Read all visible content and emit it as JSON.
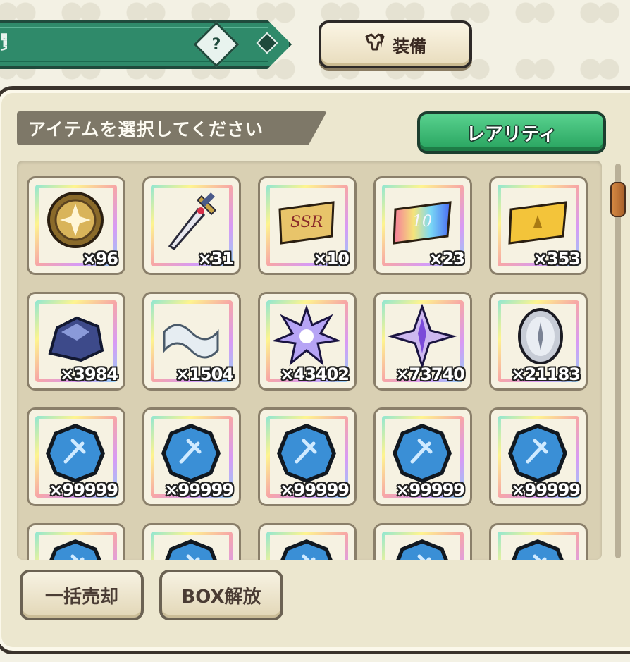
{
  "header": {
    "title_fragment": "覧",
    "help_label": "?",
    "equip_label": "装備",
    "equip_icon": "armor-icon"
  },
  "panel": {
    "instruction": "アイテムを選択してください",
    "rarity_label": "レアリティ"
  },
  "items": [
    {
      "icon": "gold-medal-icon",
      "count": "×96"
    },
    {
      "icon": "sword-icon",
      "count": "×31"
    },
    {
      "icon": "ssr-ticket-icon",
      "count": "×10"
    },
    {
      "icon": "rainbow-10-ticket-icon",
      "count": "×23"
    },
    {
      "icon": "gold-ticket-icon",
      "count": "×353"
    },
    {
      "icon": "ore-icon",
      "count": "×3984"
    },
    {
      "icon": "cloth-icon",
      "count": "×1504"
    },
    {
      "icon": "star-burst-crystal-icon",
      "count": "×43402"
    },
    {
      "icon": "purple-star-crystal-icon",
      "count": "×73740"
    },
    {
      "icon": "silver-coin-icon",
      "count": "×21183"
    },
    {
      "icon": "blue-gem-icon",
      "count": "×99999"
    },
    {
      "icon": "blue-gem-icon",
      "count": "×99999"
    },
    {
      "icon": "blue-gem-icon",
      "count": "×99999"
    },
    {
      "icon": "blue-gem-icon",
      "count": "×99999"
    },
    {
      "icon": "blue-gem-icon",
      "count": "×99999"
    },
    {
      "icon": "blue-gem-icon",
      "count": ""
    },
    {
      "icon": "blue-gem-icon",
      "count": ""
    },
    {
      "icon": "blue-gem-icon",
      "count": ""
    },
    {
      "icon": "blue-gem-icon",
      "count": ""
    },
    {
      "icon": "blue-gem-icon",
      "count": ""
    }
  ],
  "bottom": {
    "bulk_sell_label": "一括売却",
    "box_release_label": "BOX解放"
  }
}
